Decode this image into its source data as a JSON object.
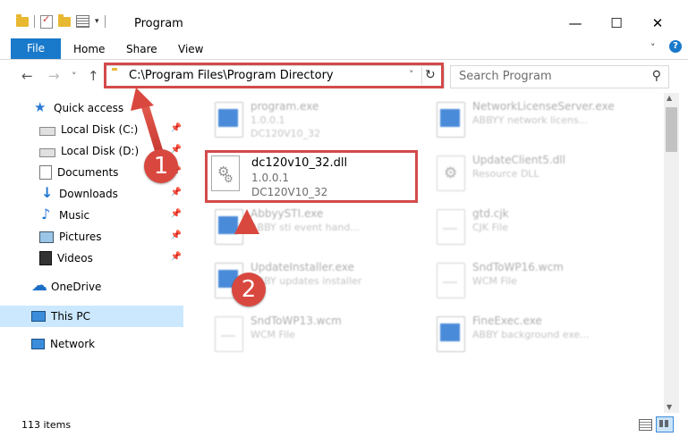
{
  "window": {
    "title": "Program",
    "minimize_glyph": "—",
    "maximize_glyph": "☐",
    "close_glyph": "✕"
  },
  "ribbon": {
    "file": "File",
    "tabs": [
      "Home",
      "Share",
      "View"
    ],
    "expand_glyph": "˅",
    "help_glyph": "?"
  },
  "nav_buttons": {
    "back": "←",
    "forward": "→",
    "recent": "˅",
    "up": "↑"
  },
  "address": {
    "path": "C:\\Program Files\\Program Directory",
    "dropdown_glyph": "˅",
    "refresh_glyph": "↻"
  },
  "search": {
    "placeholder": "Search Program",
    "icon_glyph": "⚲"
  },
  "sidebar": {
    "items": [
      {
        "label": "Quick access",
        "icon": "star-icon"
      },
      {
        "label": "Local Disk (C:)",
        "icon": "drive-icon"
      },
      {
        "label": "Local Disk (D:)",
        "icon": "drive-icon"
      },
      {
        "label": "Documents",
        "icon": "documents-icon"
      },
      {
        "label": "Downloads",
        "icon": "downloads-icon"
      },
      {
        "label": "Music",
        "icon": "music-icon"
      },
      {
        "label": "Pictures",
        "icon": "pictures-icon"
      },
      {
        "label": "Videos",
        "icon": "videos-icon"
      },
      {
        "label": "OneDrive",
        "icon": "cloud-icon"
      },
      {
        "label": "This PC",
        "icon": "pc-icon"
      },
      {
        "label": "Network",
        "icon": "network-icon"
      }
    ],
    "pin_glyph": "📌"
  },
  "files": [
    {
      "name": "program.exe",
      "line1": "1.0.0.1",
      "line2": "DC120V10_32"
    },
    {
      "name": "NetworkLicenseServer.exe",
      "line1": "ABBYY network licens...",
      "line2": ""
    },
    {
      "name": "UpdateClient5.dll",
      "line1": "Resource DLL",
      "line2": ""
    },
    {
      "name": "AbbyySTI.exe",
      "line1": "ABBY sti event hand...",
      "line2": ""
    },
    {
      "name": "gtd.cjk",
      "line1": "CJK File",
      "line2": ""
    },
    {
      "name": "UpdateInstaller.exe",
      "line1": "ABBY updates installer",
      "line2": ""
    },
    {
      "name": "SndToWP16.wcm",
      "line1": "WCM File",
      "line2": ""
    },
    {
      "name": "SndToWP13.wcm",
      "line1": "WCM File",
      "line2": ""
    },
    {
      "name": "FineExec.exe",
      "line1": "ABBY background exe...",
      "line2": ""
    }
  ],
  "highlighted_file": {
    "name": "dc120v10_32.dll",
    "line1": "1.0.0.1",
    "line2": "DC120V10_32"
  },
  "markers": {
    "one": "1",
    "two": "2"
  },
  "colors": {
    "accent": "#1979ca",
    "highlight": "#d34a4a",
    "marker": "#d9483f",
    "selected": "#cce8ff"
  },
  "status": {
    "items": "113 items"
  },
  "scrollbar": {
    "up_glyph": "▲",
    "down_glyph": "▼"
  }
}
